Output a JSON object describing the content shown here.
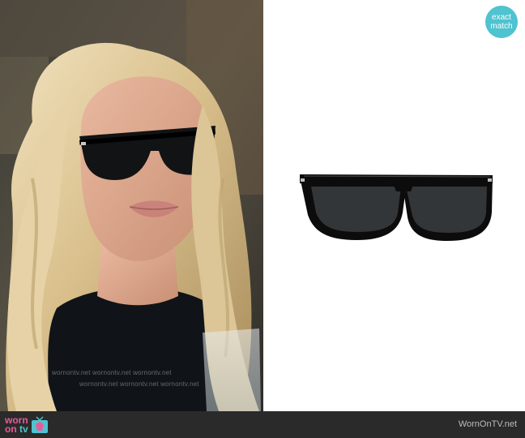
{
  "badge": {
    "line1": "exact",
    "line2": "match"
  },
  "watermark": {
    "text": "wornontv.net wornontv.net wornontv.net"
  },
  "footer": {
    "logo_word1": "worn",
    "logo_word2": "on",
    "logo_word3": "tv",
    "site_name": "WornOnTV.net"
  },
  "colors": {
    "accent_teal": "#4fc3cf",
    "accent_pink": "#e85b9a",
    "footer_bg": "#2a2a2a"
  }
}
